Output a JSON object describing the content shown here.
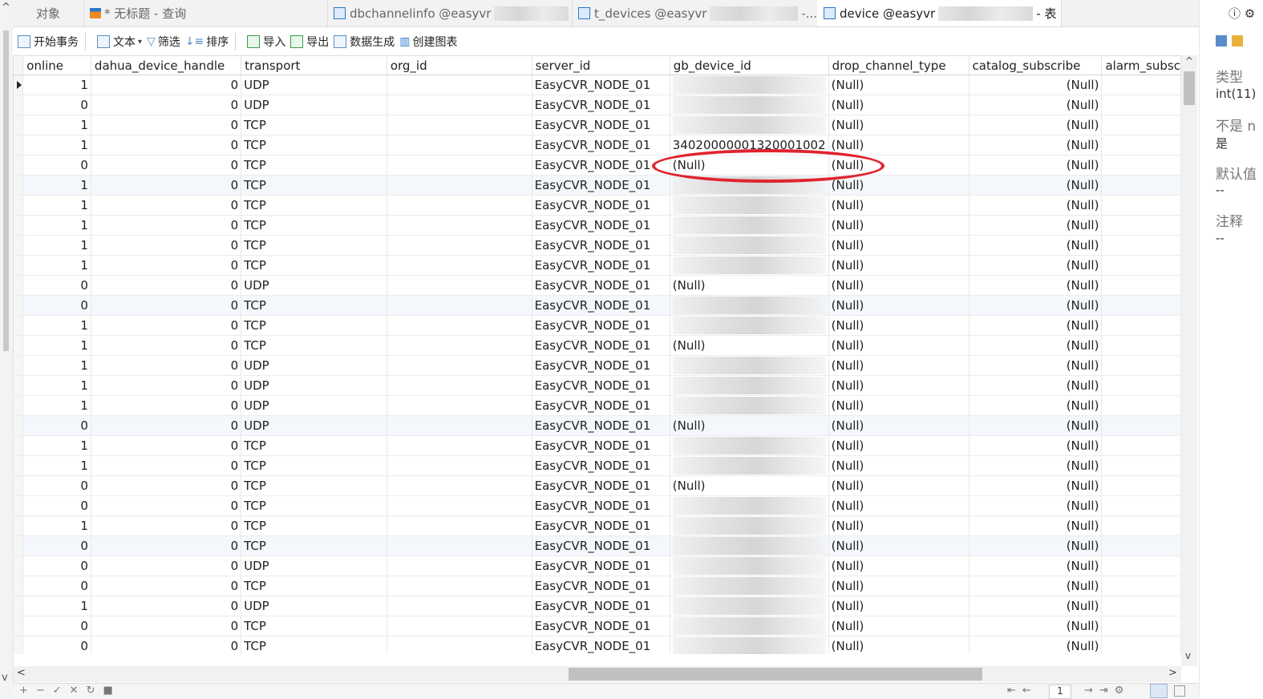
{
  "tabs": [
    {
      "label": "对象"
    },
    {
      "label": "* 无标题 - 查询"
    },
    {
      "label": "dbchannelinfo @easyvr"
    },
    {
      "label": "t_devices @easyvr"
    },
    {
      "label": "-..."
    },
    {
      "label": "device @easyvr"
    },
    {
      "label": "- 表"
    }
  ],
  "toolbar": {
    "begin_tx": "开始事务",
    "text": "文本",
    "filter": "筛选",
    "sort": "排序",
    "import": "导入",
    "export": "导出",
    "data_gen": "数据生成",
    "create_chart": "创建图表"
  },
  "columns": [
    "online",
    "dahua_device_handle",
    "transport",
    "org_id",
    "server_id",
    "gb_device_id",
    "drop_channel_type",
    "catalog_subscribe",
    "alarm_subsc"
  ],
  "null_text": "(Null)",
  "rows": [
    {
      "online": "1",
      "handle": "0",
      "transport": "UDP",
      "server": "EasyCVR_NODE_01",
      "gb": "",
      "gb_state": "blur"
    },
    {
      "online": "0",
      "handle": "0",
      "transport": "UDP",
      "server": "EasyCVR_NODE_01",
      "gb": "",
      "gb_state": "blur"
    },
    {
      "online": "1",
      "handle": "0",
      "transport": "TCP",
      "server": "EasyCVR_NODE_01",
      "gb": "",
      "gb_state": "blur"
    },
    {
      "online": "1",
      "handle": "0",
      "transport": "TCP",
      "server": "EasyCVR_NODE_01",
      "gb": "34020000001320001002",
      "gb_state": "text"
    },
    {
      "online": "0",
      "handle": "0",
      "transport": "TCP",
      "server": "EasyCVR_NODE_01",
      "gb": "(Null)",
      "gb_state": "null"
    },
    {
      "online": "1",
      "handle": "0",
      "transport": "TCP",
      "server": "EasyCVR_NODE_01",
      "gb": "",
      "gb_state": "blur"
    },
    {
      "online": "1",
      "handle": "0",
      "transport": "TCP",
      "server": "EasyCVR_NODE_01",
      "gb": "",
      "gb_state": "blur"
    },
    {
      "online": "1",
      "handle": "0",
      "transport": "TCP",
      "server": "EasyCVR_NODE_01",
      "gb": "",
      "gb_state": "blur"
    },
    {
      "online": "1",
      "handle": "0",
      "transport": "TCP",
      "server": "EasyCVR_NODE_01",
      "gb": "",
      "gb_state": "blur"
    },
    {
      "online": "1",
      "handle": "0",
      "transport": "TCP",
      "server": "EasyCVR_NODE_01",
      "gb": "",
      "gb_state": "blur"
    },
    {
      "online": "0",
      "handle": "0",
      "transport": "UDP",
      "server": "EasyCVR_NODE_01",
      "gb": "(Null)",
      "gb_state": "null"
    },
    {
      "online": "0",
      "handle": "0",
      "transport": "TCP",
      "server": "EasyCVR_NODE_01",
      "gb": "",
      "gb_state": "blur"
    },
    {
      "online": "1",
      "handle": "0",
      "transport": "TCP",
      "server": "EasyCVR_NODE_01",
      "gb": "",
      "gb_state": "blur"
    },
    {
      "online": "1",
      "handle": "0",
      "transport": "TCP",
      "server": "EasyCVR_NODE_01",
      "gb": "(Null)",
      "gb_state": "null"
    },
    {
      "online": "1",
      "handle": "0",
      "transport": "UDP",
      "server": "EasyCVR_NODE_01",
      "gb": "",
      "gb_state": "blur"
    },
    {
      "online": "1",
      "handle": "0",
      "transport": "UDP",
      "server": "EasyCVR_NODE_01",
      "gb": "",
      "gb_state": "blur"
    },
    {
      "online": "1",
      "handle": "0",
      "transport": "UDP",
      "server": "EasyCVR_NODE_01",
      "gb": "",
      "gb_state": "blur"
    },
    {
      "online": "0",
      "handle": "0",
      "transport": "UDP",
      "server": "EasyCVR_NODE_01",
      "gb": "(Null)",
      "gb_state": "null"
    },
    {
      "online": "1",
      "handle": "0",
      "transport": "TCP",
      "server": "EasyCVR_NODE_01",
      "gb": "",
      "gb_state": "blur"
    },
    {
      "online": "1",
      "handle": "0",
      "transport": "TCP",
      "server": "EasyCVR_NODE_01",
      "gb": "",
      "gb_state": "blur"
    },
    {
      "online": "0",
      "handle": "0",
      "transport": "TCP",
      "server": "EasyCVR_NODE_01",
      "gb": "(Null)",
      "gb_state": "null"
    },
    {
      "online": "0",
      "handle": "0",
      "transport": "TCP",
      "server": "EasyCVR_NODE_01",
      "gb": "",
      "gb_state": "blur"
    },
    {
      "online": "1",
      "handle": "0",
      "transport": "TCP",
      "server": "EasyCVR_NODE_01",
      "gb": "",
      "gb_state": "blur"
    },
    {
      "online": "0",
      "handle": "0",
      "transport": "TCP",
      "server": "EasyCVR_NODE_01",
      "gb": "",
      "gb_state": "blur"
    },
    {
      "online": "0",
      "handle": "0",
      "transport": "UDP",
      "server": "EasyCVR_NODE_01",
      "gb": "",
      "gb_state": "blur"
    },
    {
      "online": "0",
      "handle": "0",
      "transport": "TCP",
      "server": "EasyCVR_NODE_01",
      "gb": "",
      "gb_state": "blur"
    },
    {
      "online": "1",
      "handle": "0",
      "transport": "UDP",
      "server": "EasyCVR_NODE_01",
      "gb": "",
      "gb_state": "blur"
    },
    {
      "online": "0",
      "handle": "0",
      "transport": "TCP",
      "server": "EasyCVR_NODE_01",
      "gb": "",
      "gb_state": "blur"
    },
    {
      "online": "0",
      "handle": "0",
      "transport": "TCP",
      "server": "EasyCVR_NODE_01",
      "gb": "",
      "gb_state": "blur"
    }
  ],
  "side_panel": {
    "type_label": "类型",
    "type_value": "int(11)",
    "notnull_label": "不是 n",
    "notnull_value": "是",
    "default_label": "默认值",
    "default_value": "--",
    "comment_label": "注释",
    "comment_value": "--"
  },
  "status": {
    "page": "1"
  },
  "colors": {
    "annotation": "#e0242f",
    "null_text": "#b5b5b5",
    "alt_row": "#f4f7fb"
  }
}
